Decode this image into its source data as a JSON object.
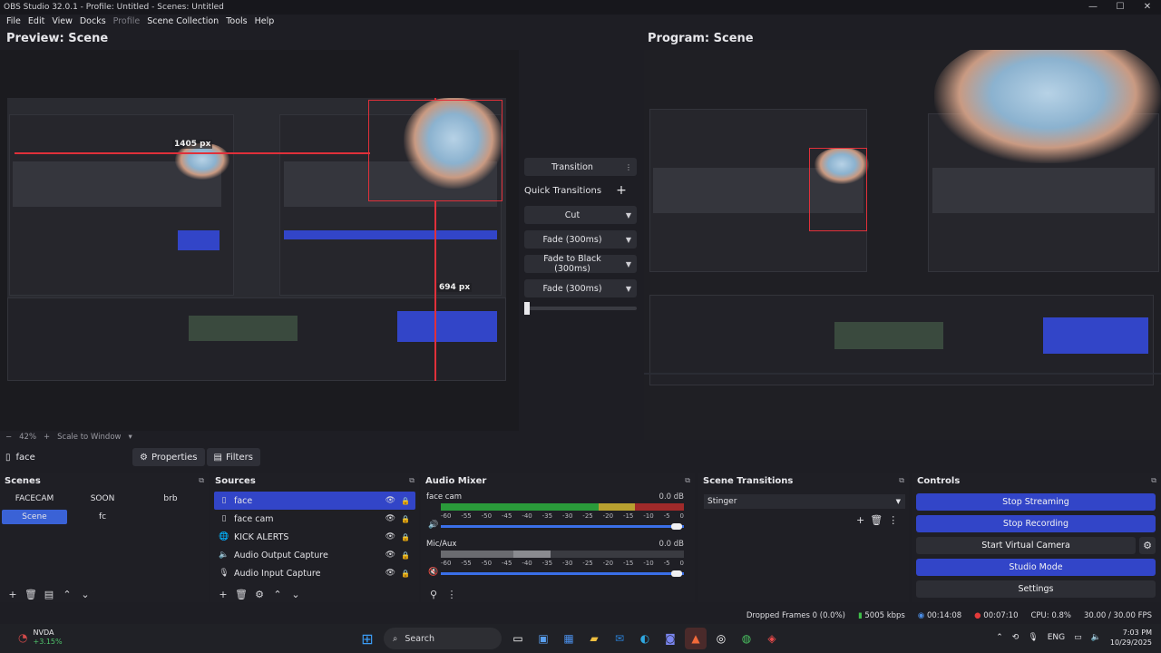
{
  "window": {
    "title": "OBS Studio 32.0.1 - Profile: Untitled - Scenes: Untitled"
  },
  "menu": [
    "File",
    "Edit",
    "View",
    "Docks",
    "Profile",
    "Scene Collection",
    "Tools",
    "Help"
  ],
  "preview": {
    "title": "Preview: Scene",
    "measure_w": "1405 px",
    "measure_h": "694 px",
    "zoom": "42%",
    "scale_mode": "Scale to Window"
  },
  "program": {
    "title": "Program: Scene"
  },
  "transitions": {
    "transition_label": "Transition",
    "quick_label": "Quick Transitions",
    "items": [
      "Cut",
      "Fade (300ms)",
      "Fade to Black (300ms)",
      "Fade (300ms)"
    ]
  },
  "source_context": {
    "name": "face",
    "properties": "Properties",
    "filters": "Filters"
  },
  "scenes": {
    "title": "Scenes",
    "items": [
      "FACECAM",
      "SOON",
      "brb",
      "Scene",
      "fc"
    ],
    "active": "Scene"
  },
  "sources": {
    "title": "Sources",
    "items": [
      {
        "name": "face",
        "icon": "window-icon"
      },
      {
        "name": "face cam",
        "icon": "window-icon"
      },
      {
        "name": "KICK ALERTS",
        "icon": "globe-icon"
      },
      {
        "name": "Audio Output Capture",
        "icon": "speaker-icon"
      },
      {
        "name": "Audio Input Capture",
        "icon": "mic-icon"
      }
    ]
  },
  "audio_mixer": {
    "title": "Audio Mixer",
    "channels": [
      {
        "name": "face cam",
        "db": "0.0 dB",
        "level": 0.85,
        "volume": 1.0
      },
      {
        "name": "Mic/Aux",
        "db": "0.0 dB",
        "level": 0.45,
        "volume": 1.0
      }
    ],
    "scale": [
      "-60",
      "-55",
      "-50",
      "-45",
      "-40",
      "-35",
      "-30",
      "-25",
      "-20",
      "-15",
      "-10",
      "-5",
      "0"
    ]
  },
  "scene_transitions": {
    "title": "Scene Transitions",
    "selected": "Stinger"
  },
  "controls": {
    "title": "Controls",
    "stop_streaming": "Stop Streaming",
    "stop_recording": "Stop Recording",
    "start_virtual_camera": "Start Virtual Camera",
    "studio_mode": "Studio Mode",
    "settings": "Settings"
  },
  "status": {
    "dropped_frames": "Dropped Frames 0 (0.0%)",
    "bitrate": "5005 kbps",
    "stream_time": "00:14:08",
    "rec_time": "00:07:10",
    "cpu": "CPU: 0.8%",
    "fps": "30.00 / 30.00 FPS"
  },
  "taskbar": {
    "stock_name": "NVDA",
    "stock_change": "+3.15%",
    "search": "Search",
    "lang": "ENG",
    "time": "7:03 PM",
    "date": "10/29/2025"
  },
  "colors": {
    "accent": "#3245c8",
    "scene_active": "#3a62d6",
    "guide": "#e0303a"
  }
}
